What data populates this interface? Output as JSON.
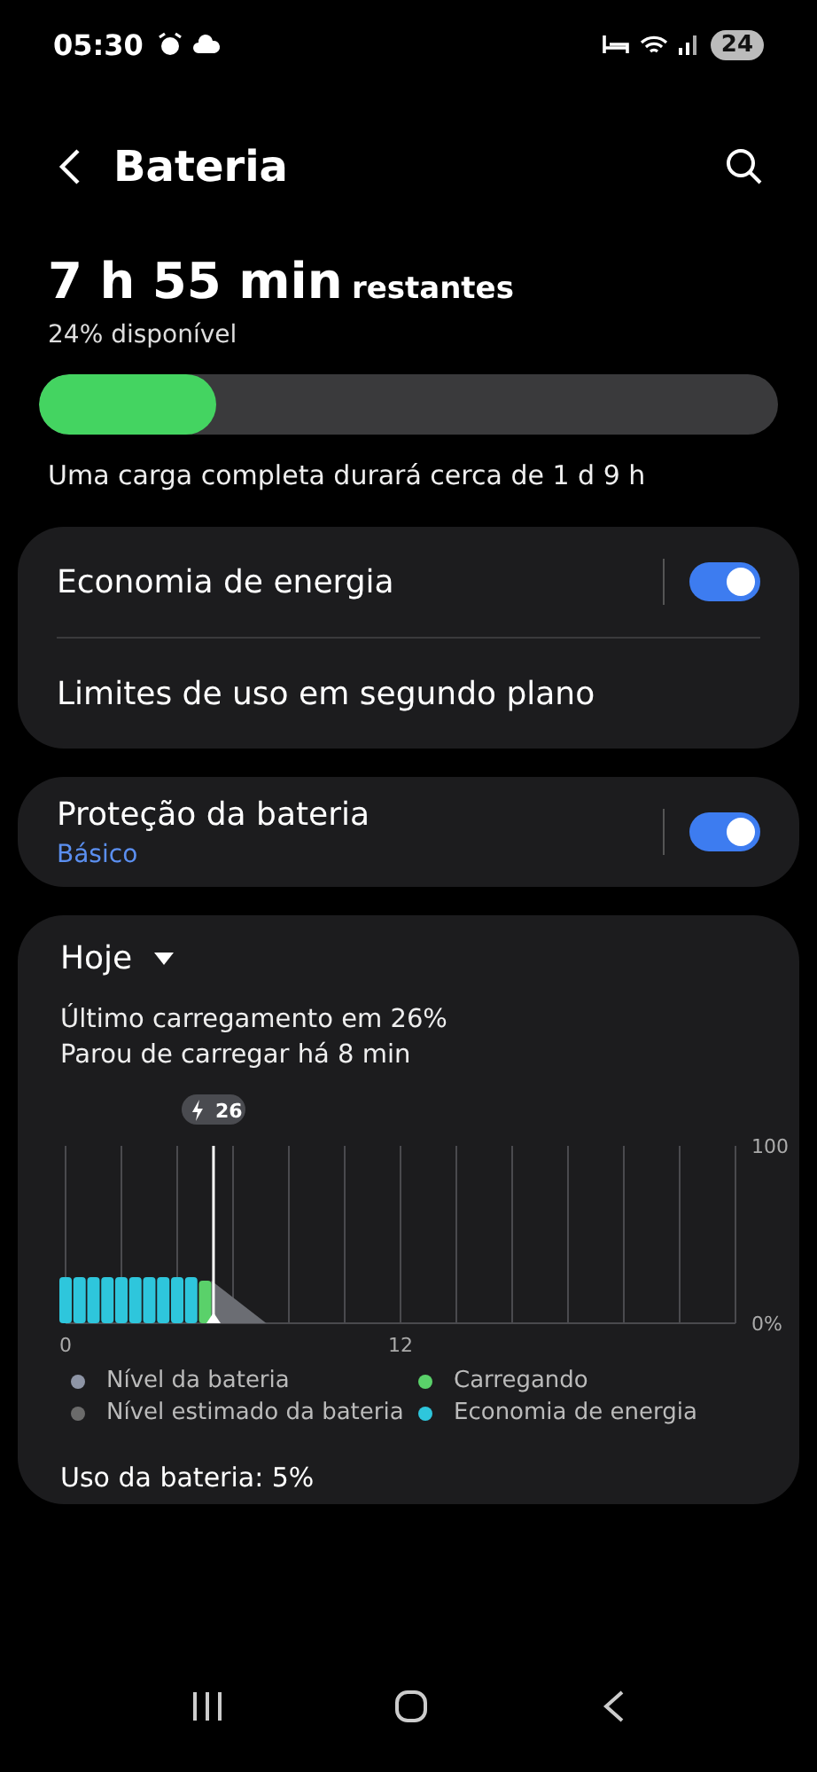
{
  "status_bar": {
    "time": "05:30",
    "battery": "24"
  },
  "header": {
    "title": "Bateria"
  },
  "summary": {
    "time_left": "7 h 55 min",
    "suffix": "restantes",
    "available": "24% disponível",
    "level": 0.24,
    "full_charge": "Uma carga completa durará cerca de 1 d 9 h"
  },
  "cards": [
    {
      "rows": [
        {
          "kind": "toggle",
          "label": "Economia de energia",
          "on": true
        },
        {
          "kind": "link",
          "label": "Limites de uso em segundo plano"
        }
      ]
    },
    {
      "rows": [
        {
          "kind": "toggle",
          "label": "Proteção da bateria",
          "subtitle": "Básico",
          "on": true
        }
      ]
    }
  ],
  "usage": {
    "period": "Hoje",
    "last_charge": "Último carregamento em 26%",
    "stopped": "Parou de carregar há 8 min",
    "chart_data": {
      "type": "bar",
      "x": [
        0,
        0.5,
        1,
        1.5,
        2,
        2.5,
        3,
        3.5,
        4,
        4.5,
        5
      ],
      "series": [
        {
          "name": "Economia de energia",
          "color": "#2ec6dc",
          "values": [
            26,
            26,
            26,
            26,
            26,
            26,
            26,
            26,
            26,
            26,
            null
          ]
        },
        {
          "name": "Carregando",
          "color": "#5ad16a",
          "values": [
            null,
            null,
            null,
            null,
            null,
            null,
            null,
            null,
            null,
            null,
            24
          ]
        }
      ],
      "xlim": [
        0,
        24
      ],
      "ylim": [
        0,
        100
      ],
      "xticks": [
        0,
        12
      ],
      "yticks": [
        {
          "value": 0,
          "label": "0%"
        },
        {
          "value": 100,
          "label": "100"
        }
      ]
    },
    "charge_marker": "26",
    "legend": [
      {
        "label": "Nível da bateria",
        "color": "#8e95a6"
      },
      {
        "label": "Nível estimado da bateria",
        "color": "#6b6b6b"
      }
    ],
    "battery_use": "Uso da bateria: 5%"
  }
}
